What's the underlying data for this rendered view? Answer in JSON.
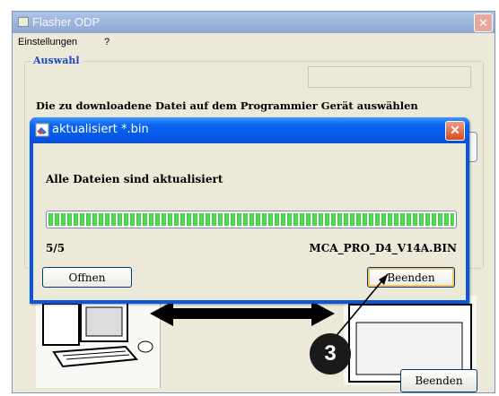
{
  "main_window": {
    "title": "Flasher ODP",
    "menu": [
      "Einstellungen",
      "?"
    ],
    "group_label": "Auswahl",
    "instruction": "Die zu downloadene Datei auf dem Programmier Gerät auswählen",
    "bottom_button": "Beenden"
  },
  "dialog": {
    "title": "aktualisiert *.bin",
    "message": "Alle Dateien sind aktualisiert",
    "progress": 1.0,
    "count": "5/5",
    "filename": "MCA_PRO_D4_V14A.BIN",
    "open_button": "Offnen",
    "close_button": "Beenden"
  },
  "callout": {
    "number": "3"
  },
  "colors": {
    "title_blue": "#0a57de",
    "progress_green": "#37c83a",
    "callout": "#1a1a1a"
  }
}
